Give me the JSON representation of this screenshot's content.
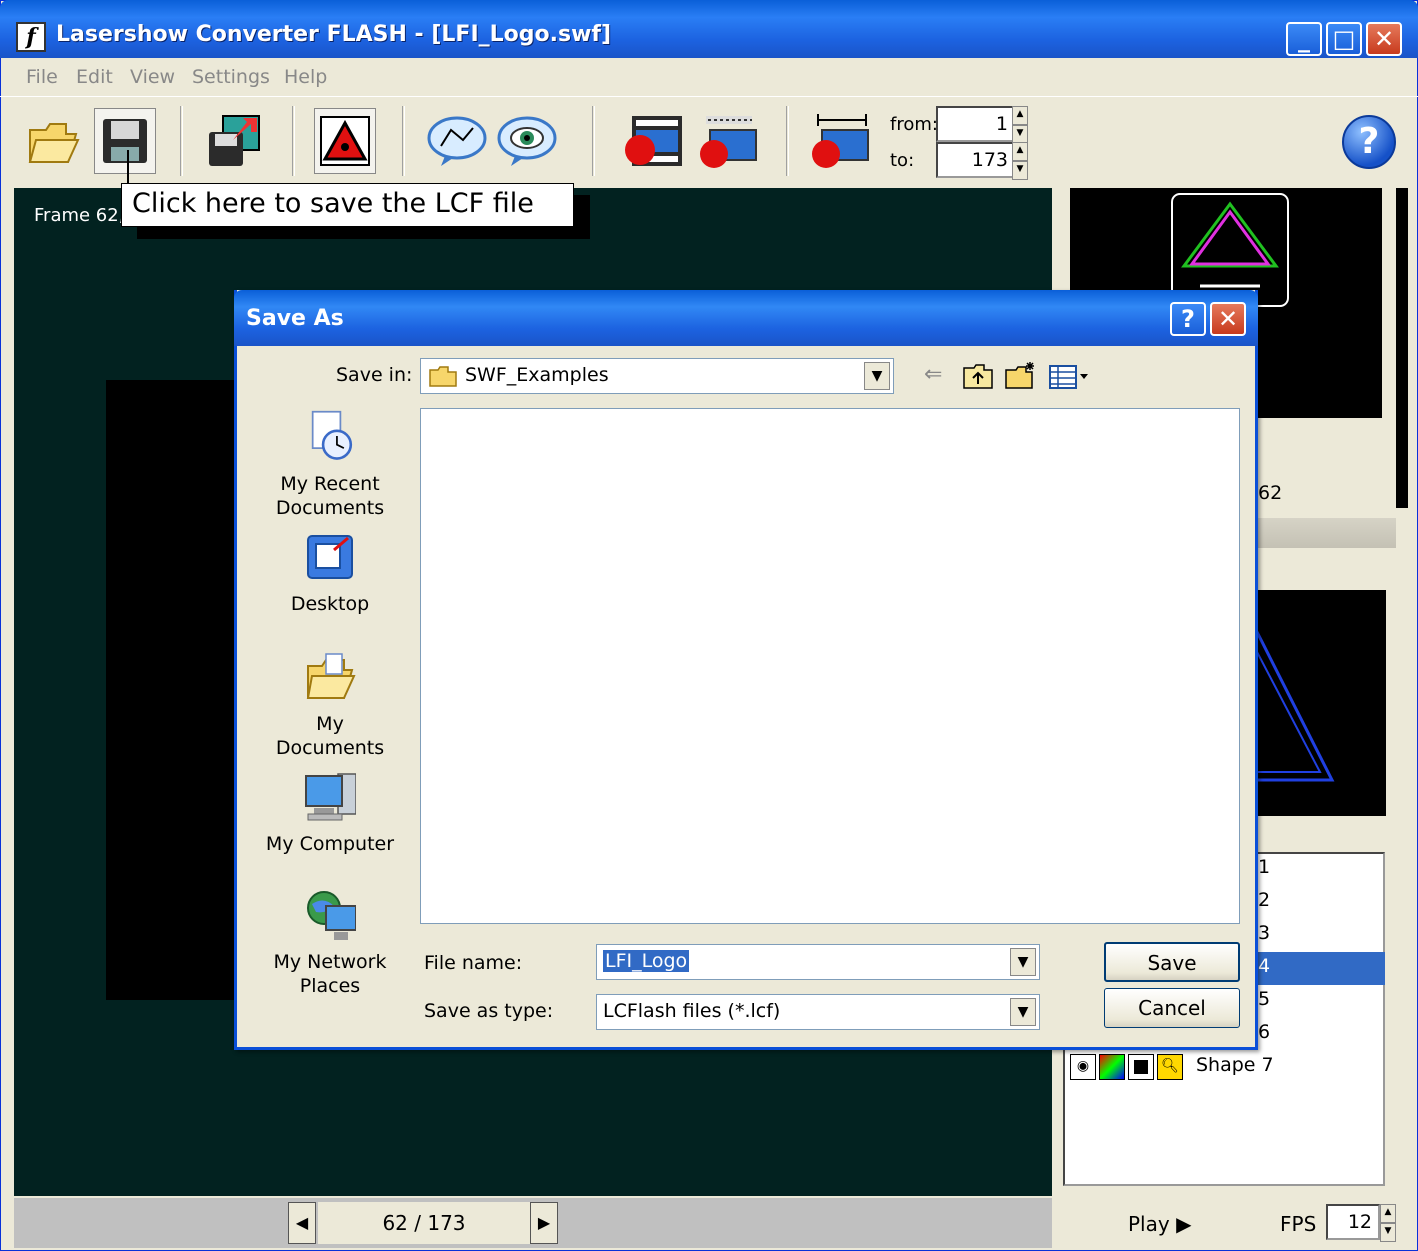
{
  "window": {
    "title": "Lasershow Converter FLASH - [LFI_Logo.swf]",
    "logo_glyph": "f",
    "min_glyph": "_",
    "max_glyph": "□",
    "close_glyph": "✕"
  },
  "menu": [
    "File",
    "Edit",
    "View",
    "Settings",
    "Help"
  ],
  "toolbar": {
    "from_label": "from:",
    "from_value": "1",
    "to_label": "to:",
    "to_value": "173",
    "help_glyph": "?",
    "icons": [
      "open-folder-icon",
      "save-disk-icon",
      "export-icon",
      "laser-warning-icon",
      "path-edit-icon",
      "preview-eye-icon",
      "record-frames-icon",
      "record-all-icon",
      "record-range-icon",
      "help-icon"
    ]
  },
  "callout": {
    "text": "Click here to save the LCF file"
  },
  "stage": {
    "frame_label": "Frame 62,"
  },
  "right_panel": {
    "frame_partial": "62",
    "layers": [
      {
        "label": "1"
      },
      {
        "label": "2"
      },
      {
        "label": "3"
      },
      {
        "label": "4",
        "selected": true
      },
      {
        "label": "5"
      },
      {
        "label": "6"
      },
      {
        "label": "Shape 7"
      }
    ]
  },
  "status": {
    "frame_counter": "62 / 173",
    "prev_glyph": "◀",
    "next_glyph": "▶",
    "play_label": "Play ▶",
    "fps_label": "FPS",
    "fps_value": "12"
  },
  "dialog": {
    "title": "Save As",
    "help_glyph": "?",
    "close_glyph": "✕",
    "save_in_label": "Save in:",
    "save_in_value": "SWF_Examples",
    "places": [
      {
        "label": "My Recent Documents",
        "icon": "recent-documents-icon"
      },
      {
        "label": "Desktop",
        "icon": "desktop-icon"
      },
      {
        "label": "My Documents",
        "icon": "my-documents-icon"
      },
      {
        "label": "My Computer",
        "icon": "my-computer-icon"
      },
      {
        "label": "My Network Places",
        "icon": "network-places-icon"
      }
    ],
    "file_name_label": "File name:",
    "file_name_value": "LFI_Logo",
    "save_type_label": "Save as type:",
    "save_type_value": "LCFlash files (*.lcf)",
    "save_button": "Save",
    "cancel_button": "Cancel",
    "dropdown_glyph": "▼",
    "back_glyph": "⇐"
  }
}
